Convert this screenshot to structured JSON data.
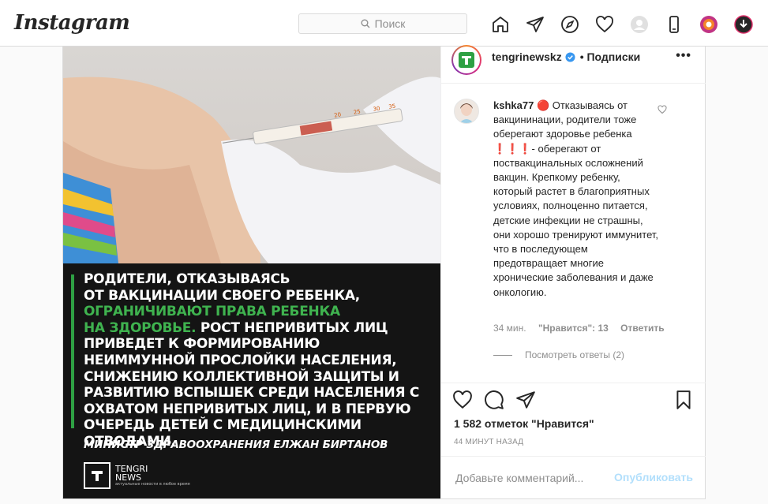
{
  "app": {
    "logo": "Instagram"
  },
  "search": {
    "placeholder": "Поиск"
  },
  "nav": {
    "icons": [
      "home-icon",
      "direct-icon",
      "explore-icon",
      "activity-heart-icon",
      "profile-avatar-icon",
      "mobile-icon",
      "extension-icon",
      "download-icon"
    ]
  },
  "post": {
    "author": "tengrinewskz",
    "follow_label": "• Подписки",
    "more": "•••",
    "image": {
      "quote_line1": "Родители, отказываясь",
      "quote_line2": "от вакцинации своего ребенка,",
      "quote_line3_hl": "ограничивают права ребенка",
      "quote_line4_hl": "на здоровье.",
      "quote_line4_rest": " Рост непривитых лиц",
      "quote_rest": "приведет к формированию неиммунной прослойки населения, снижению коллективной защиты и развитию вспышек среди населения с охватом непривитых лиц, и в первую очередь детей с медицинскими отводами.",
      "attribution": "Министр здравоохранения Елжан Биртанов",
      "brand_line1": "TENGRI",
      "brand_line2": "NEWS",
      "brand_sub": "актуальные новости в любое время"
    },
    "comment": {
      "user": "kshka77",
      "text": " 🔴 Отказываясь от вакцининации, родители тоже оберегают здоровье ребенка ❗❗❗- оберегают от поствакцинальных осложнений вакцин. Крепкому ребенку, который растет в благоприятных условиях, полноценно питается, детские инфекции не страшны, они хорошо тренируют иммунитет, что в последующем предотвращает многие хронические заболевания и даже онкологию.",
      "age": "34 мин.",
      "likes": "\"Нравится\": 13",
      "reply": "Ответить",
      "view_replies": "Посмотреть ответы (2)"
    },
    "likes": "1 582 отметок \"Нравится\"",
    "time": "44 МИНУТ НАЗАД",
    "add_comment_placeholder": "Добавьте комментарий...",
    "publish": "Опубликовать"
  },
  "colors": {
    "accent": "#0095f6",
    "publish_disabled": "#b2dffc",
    "quote_highlight": "#3fb34f",
    "border": "#dbdbdb"
  }
}
